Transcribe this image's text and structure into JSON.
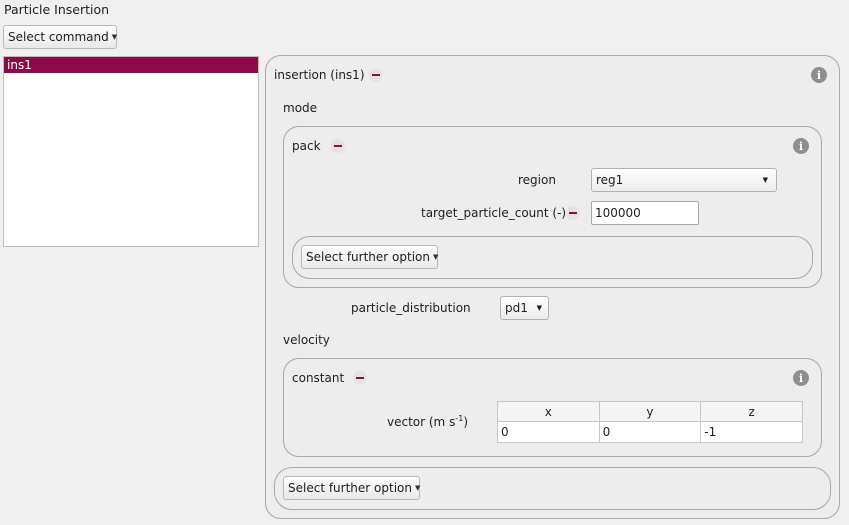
{
  "title": "Particle Insertion",
  "select_command": {
    "label": "Select command",
    "icon": "caret-down-icon"
  },
  "list": {
    "items": [
      {
        "label": "ins1",
        "selected": true
      }
    ]
  },
  "colors": {
    "accent": "#8b0a47",
    "selection": "#8b0a47",
    "info_icon": "#8e8e8e"
  },
  "insertion": {
    "label": "insertion (ins1)",
    "mode": {
      "label": "mode",
      "pack": {
        "label": "pack",
        "region_label": "region",
        "region_value": "reg1",
        "count_label": "target_particle_count (-)",
        "count_value": "100000",
        "further_option": "Select further option"
      }
    },
    "particle_distribution": {
      "label": "particle_distribution",
      "value": "pd1"
    },
    "velocity": {
      "label": "velocity",
      "constant": {
        "label": "constant",
        "vector_label": "vector (m s",
        "vector_exp": "-1",
        "vector_close": ")",
        "columns": [
          "x",
          "y",
          "z"
        ],
        "values": [
          "0",
          "0",
          "-1"
        ]
      }
    },
    "further_option": "Select further option"
  }
}
